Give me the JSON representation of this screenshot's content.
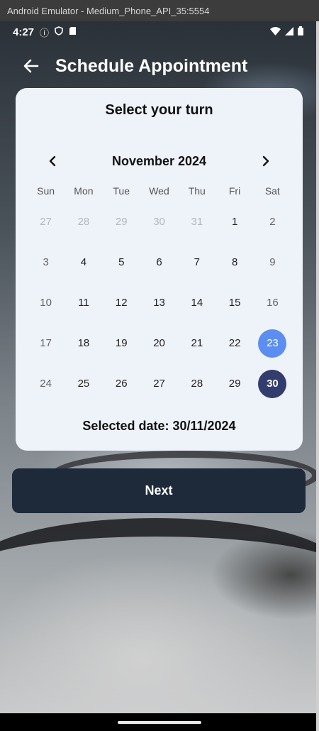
{
  "window": {
    "title": "Android Emulator - Medium_Phone_API_35:5554"
  },
  "status_bar": {
    "time": "4:27"
  },
  "appbar": {
    "title": "Schedule Appointment"
  },
  "calendar": {
    "heading": "Select your turn",
    "month_label": "November 2024",
    "weekdays": [
      "Sun",
      "Mon",
      "Tue",
      "Wed",
      "Thu",
      "Fri",
      "Sat"
    ],
    "days": [
      {
        "label": "27",
        "state": "muted"
      },
      {
        "label": "28",
        "state": "muted"
      },
      {
        "label": "29",
        "state": "muted"
      },
      {
        "label": "30",
        "state": "muted"
      },
      {
        "label": "31",
        "state": "muted"
      },
      {
        "label": "1",
        "state": "normal"
      },
      {
        "label": "2",
        "state": "weekend"
      },
      {
        "label": "3",
        "state": "weekend"
      },
      {
        "label": "4",
        "state": "normal"
      },
      {
        "label": "5",
        "state": "normal"
      },
      {
        "label": "6",
        "state": "normal"
      },
      {
        "label": "7",
        "state": "normal"
      },
      {
        "label": "8",
        "state": "normal"
      },
      {
        "label": "9",
        "state": "weekend"
      },
      {
        "label": "10",
        "state": "weekend"
      },
      {
        "label": "11",
        "state": "normal"
      },
      {
        "label": "12",
        "state": "normal"
      },
      {
        "label": "13",
        "state": "normal"
      },
      {
        "label": "14",
        "state": "normal"
      },
      {
        "label": "15",
        "state": "normal"
      },
      {
        "label": "16",
        "state": "weekend"
      },
      {
        "label": "17",
        "state": "weekend"
      },
      {
        "label": "18",
        "state": "normal"
      },
      {
        "label": "19",
        "state": "normal"
      },
      {
        "label": "20",
        "state": "normal"
      },
      {
        "label": "21",
        "state": "normal"
      },
      {
        "label": "22",
        "state": "normal"
      },
      {
        "label": "23",
        "state": "today"
      },
      {
        "label": "24",
        "state": "weekend"
      },
      {
        "label": "25",
        "state": "normal"
      },
      {
        "label": "26",
        "state": "normal"
      },
      {
        "label": "27",
        "state": "normal"
      },
      {
        "label": "28",
        "state": "normal"
      },
      {
        "label": "29",
        "state": "normal"
      },
      {
        "label": "30",
        "state": "selected"
      }
    ],
    "selected_date_text": "Selected date: 30/11/2024"
  },
  "actions": {
    "next_label": "Next"
  },
  "colors": {
    "today": "#5b8ef0",
    "selected": "#323d6e",
    "next_button": "#1e2a3a",
    "card": "#eef2f9"
  }
}
